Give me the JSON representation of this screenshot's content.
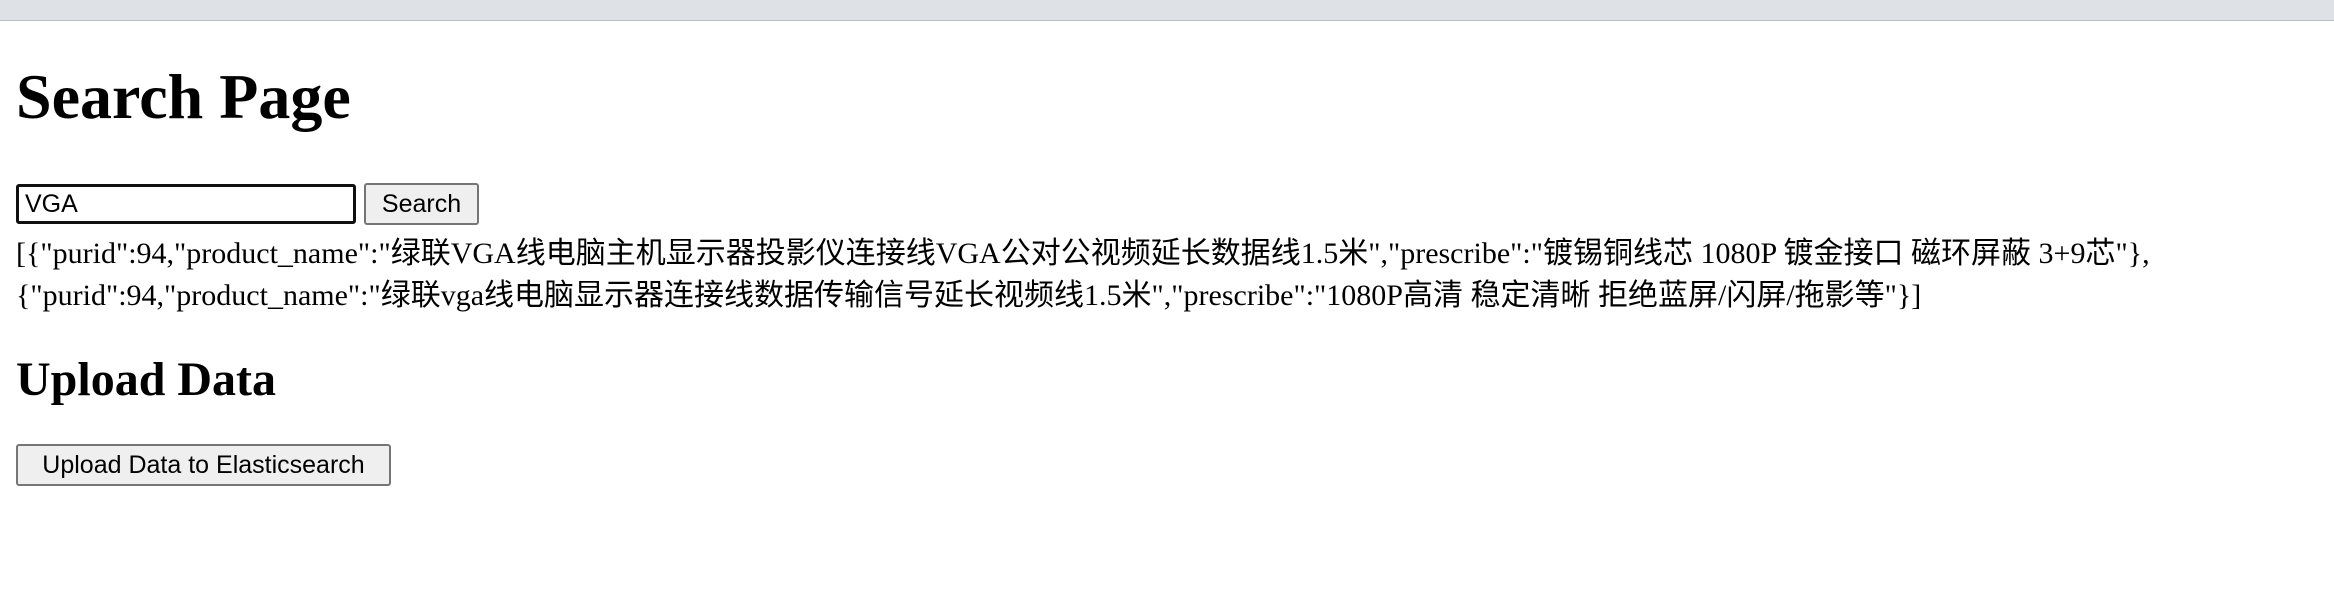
{
  "page": {
    "title": "Search Page"
  },
  "search": {
    "input_value": "VGA",
    "button_label": "Search"
  },
  "results": {
    "lines": [
      "[{\"purid\":94,\"product_name\":\"绿联VGA线电脑主机显示器投影仪连接线VGA公对公视频延长数据线1.5米\",\"prescribe\":\"镀锡铜线芯 1080P 镀金接口 磁环屏蔽 3+9芯\"},",
      "{\"purid\":94,\"product_name\":\"绿联vga线电脑显示器连接线数据传输信号延长视频线1.5米\",\"prescribe\":\"1080P高清 稳定清晰 拒绝蓝屏/闪屏/拖影等\"}]"
    ]
  },
  "upload": {
    "heading": "Upload Data",
    "button_label": "Upload Data to Elasticsearch"
  }
}
